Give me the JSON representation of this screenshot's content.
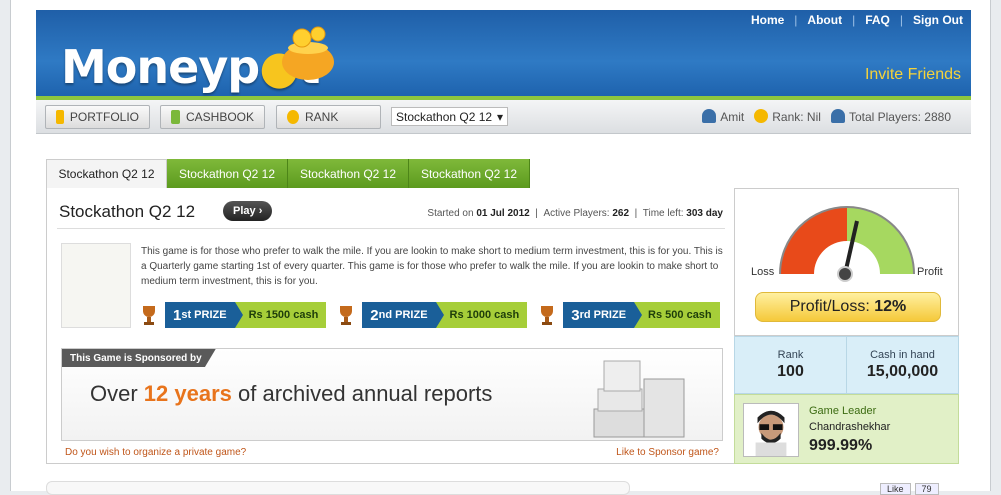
{
  "header": {
    "links": [
      "Home",
      "About",
      "FAQ",
      "Sign Out"
    ],
    "logo_text": "Moneyp",
    "logo_text_end": "t",
    "invite": "Invite Friends"
  },
  "nav": {
    "portfolio": "PORTFOLIO",
    "cashbook": "CASHBOOK",
    "rank": "RANK",
    "game_select": "Stockathon Q2 12",
    "user": "Amit",
    "rank_label": "Rank: Nil",
    "total_players": "Total Players: 2880"
  },
  "tabs": [
    "Stockathon Q2 12",
    "Stockathon Q2 12",
    "Stockathon Q2 12",
    "Stockathon Q2 12"
  ],
  "game": {
    "title": "Stockathon Q2 12",
    "play": "Play",
    "started_label": "Started on",
    "started": "01 Jul 2012",
    "players_label": "Active Players:",
    "players": "262",
    "time_label": "Time left:",
    "time_left": "303 day",
    "description": "This game is for those who prefer to walk the mile. If you are lookin to make short to medium term investment, this is for you. This is a Quarterly game starting 1st of every quarter. This game is for those who prefer to walk the mile. If you are lookin to make short to medium term investment, this is for you.",
    "prizes": [
      {
        "rank": "1",
        "suffix": "st PRIZE",
        "value": "Rs 1500 cash"
      },
      {
        "rank": "2",
        "suffix": "nd PRIZE",
        "value": "Rs 1000 cash"
      },
      {
        "rank": "3",
        "suffix": "rd PRIZE",
        "value": "Rs 500 cash"
      }
    ],
    "sponsor_tag": "This Game is Sponsored by",
    "sponsor_pre": "Over ",
    "sponsor_hl": "12 years",
    "sponsor_post": " of archived annual reports",
    "private_link": "Do you wish to organize a private game?",
    "sponsor_link": "Like to Sponsor game?"
  },
  "gauge": {
    "loss": "Loss",
    "profit": "Profit",
    "pl_label": "Profit/Loss:",
    "pl_value": "12%",
    "colors": {
      "loss": "#e84a1a",
      "profit": "#a6d860"
    }
  },
  "stats": {
    "rank_label": "Rank",
    "rank": "100",
    "cash_label": "Cash in hand",
    "cash": "15,00,000"
  },
  "leader": {
    "title": "Game Leader",
    "name": "Chandrashekhar",
    "pct": "999.99%"
  },
  "fb": {
    "like": "Like",
    "count": "79"
  }
}
